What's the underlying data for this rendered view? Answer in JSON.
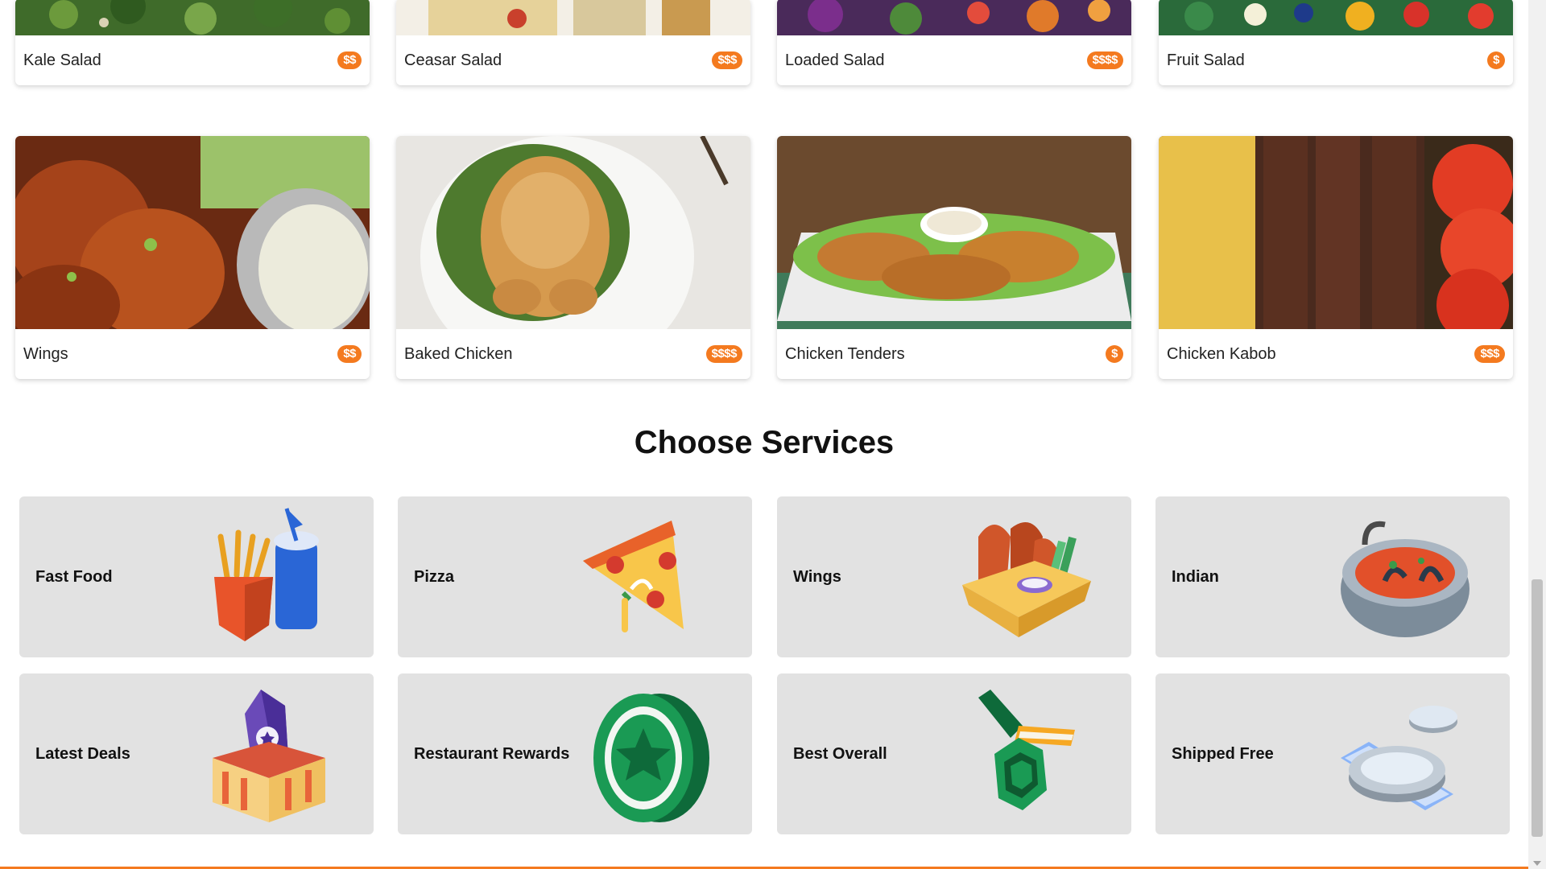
{
  "top_row": [
    {
      "name": "Kale Salad",
      "price": "$$"
    },
    {
      "name": "Ceasar Salad",
      "price": "$$$"
    },
    {
      "name": "Loaded Salad",
      "price": "$$$$"
    },
    {
      "name": "Fruit Salad",
      "price": "$"
    }
  ],
  "second_row": [
    {
      "name": "Wings",
      "price": "$$"
    },
    {
      "name": "Baked Chicken",
      "price": "$$$$"
    },
    {
      "name": "Chicken Tenders",
      "price": "$"
    },
    {
      "name": "Chicken Kabob",
      "price": "$$$"
    }
  ],
  "services": {
    "title": "Choose Services",
    "items": [
      {
        "label": "Fast Food",
        "icon": "fries-drink-icon"
      },
      {
        "label": "Pizza",
        "icon": "pizza-slice-icon"
      },
      {
        "label": "Wings",
        "icon": "wings-basket-icon"
      },
      {
        "label": "Indian",
        "icon": "curry-pot-icon"
      },
      {
        "label": "Latest Deals",
        "icon": "price-tag-box-icon"
      },
      {
        "label": "Restaurant Rewards",
        "icon": "star-coin-icon"
      },
      {
        "label": "Best Overall",
        "icon": "medal-icon"
      },
      {
        "label": "Shipped Free",
        "icon": "plates-icon"
      }
    ]
  },
  "colors": {
    "accent": "#f47a1f",
    "service_bg": "#e2e2e2"
  }
}
